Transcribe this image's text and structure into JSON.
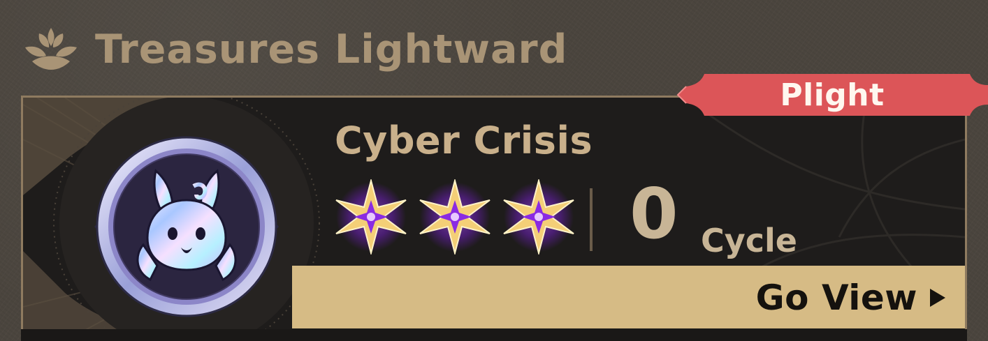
{
  "section": {
    "title": "Treasures Lightward",
    "icon": "lotus-icon"
  },
  "card": {
    "level_name": "Cyber Crisis",
    "stars_earned": 3,
    "stars_total": 3,
    "star_icon": "star-icon",
    "cycle_value": "0",
    "cycle_label": "Cycle",
    "difficulty_badge": "Plight",
    "action_label": "Go View",
    "medal_icon": "rabbit-medal-icon"
  },
  "colors": {
    "title": "#a99476",
    "card_bg": "#1e1c1b",
    "gold_bar": "#d6bb85",
    "badge_red": "#dc5558",
    "star_gold": "#f4cf77",
    "star_purple": "#8a2be2"
  }
}
